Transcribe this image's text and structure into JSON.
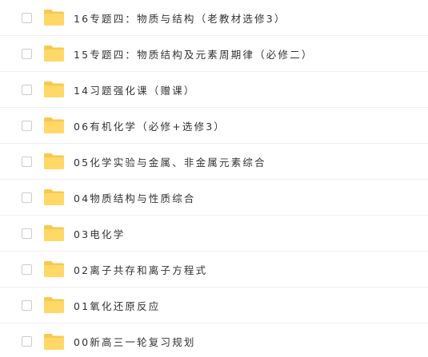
{
  "colors": {
    "folder_back": "#F7C94E",
    "folder_front": "#FFD867",
    "text": "#333333",
    "checkbox_border": "#C9CCD1",
    "divider": "#EEF0F2"
  },
  "icons": {
    "checkbox": "checkbox-unchecked",
    "folder": "folder-icon"
  },
  "files": [
    {
      "name": "16专题四：物质与结构（老教材选修3）"
    },
    {
      "name": "15专题四：物质结构及元素周期律（必修二）"
    },
    {
      "name": "14习题强化课（赠课）"
    },
    {
      "name": "06有机化学（必修+选修3）"
    },
    {
      "name": "05化学实验与金属、非金属元素综合"
    },
    {
      "name": "04物质结构与性质综合"
    },
    {
      "name": "03电化学"
    },
    {
      "name": "02离子共存和离子方程式"
    },
    {
      "name": "01氧化还原反应"
    },
    {
      "name": "00新高三一轮复习规划"
    }
  ]
}
